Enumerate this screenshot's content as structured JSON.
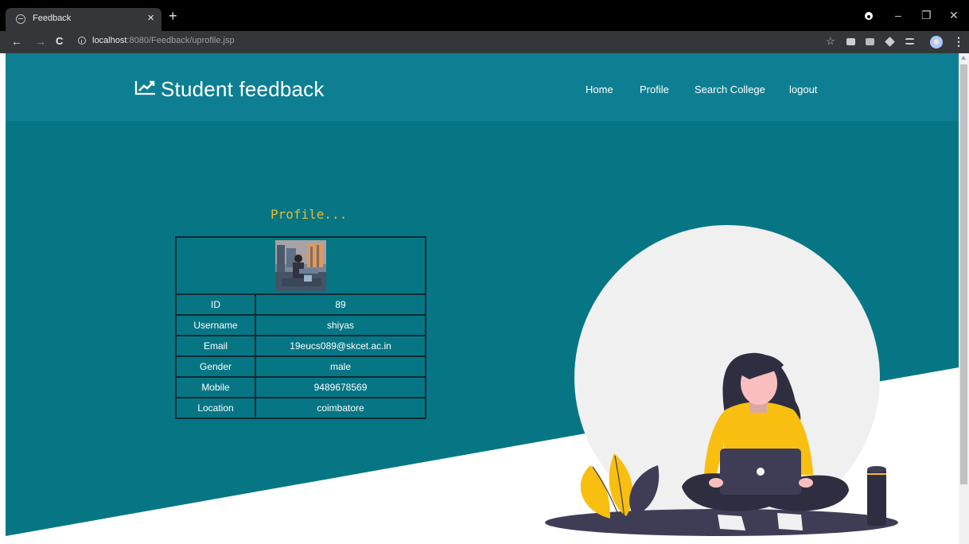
{
  "browser": {
    "tab_title": "Feedback",
    "tab_close": "×",
    "new_tab": "+",
    "url_host": "localhost",
    "url_path": ":8080/Feedback/uprofile.jsp",
    "controls": {
      "minimize": "–",
      "maximize": "❐",
      "close": "✕"
    },
    "nav": {
      "back": "←",
      "forward": "→",
      "reload": "C"
    },
    "star": "☆",
    "menu": "⋮"
  },
  "site": {
    "title": "Student feedback",
    "nav": [
      "Home",
      "Profile",
      "Search College",
      "logout"
    ]
  },
  "profile": {
    "heading": "Profile...",
    "rows": [
      {
        "label": "ID",
        "value": "89"
      },
      {
        "label": "Username",
        "value": "shiyas"
      },
      {
        "label": "Email",
        "value": "19eucs089@skcet.ac.in"
      },
      {
        "label": "Gender",
        "value": "male"
      },
      {
        "label": "Mobile",
        "value": "9489678569"
      },
      {
        "label": "Location",
        "value": "coimbatore"
      }
    ]
  },
  "colors": {
    "header": "#0e7f92",
    "background": "#067685",
    "accent_heading": "#e7b93a",
    "illustration_yellow": "#f8bf11",
    "illustration_dark": "#3f3d56"
  }
}
